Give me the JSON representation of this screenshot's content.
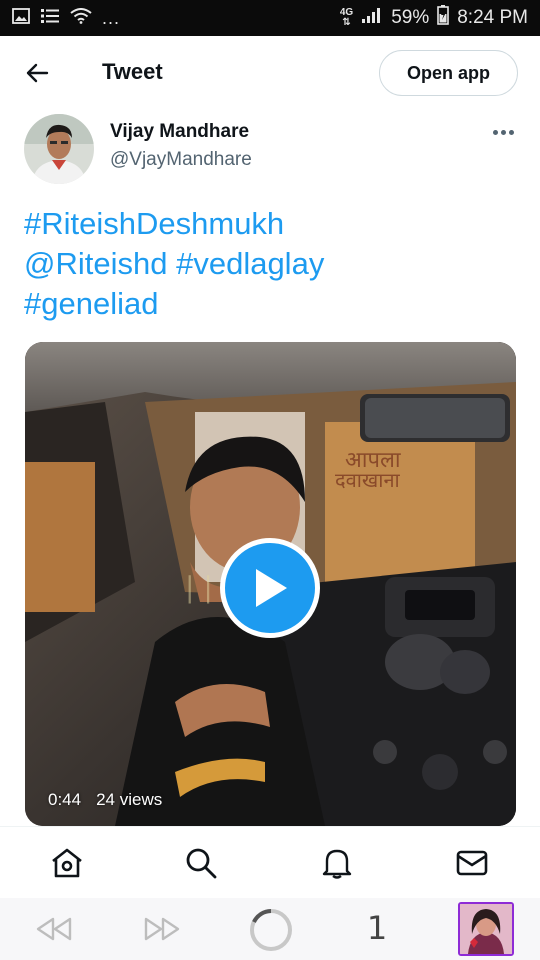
{
  "status_bar": {
    "network_label": "4G",
    "battery": "59%",
    "time": "8:24 PM",
    "overflow_dots": "...",
    "icons": [
      "image-icon",
      "list-icon",
      "wifi-icon",
      "network-arrows-icon",
      "signal-icon",
      "battery-icon"
    ]
  },
  "header": {
    "title": "Tweet",
    "open_app_label": "Open app"
  },
  "author": {
    "name": "Vijay Mandhare",
    "handle": "@VjayMandhare"
  },
  "tweet": {
    "line1": "#RiteishDeshmukh",
    "line2_mention": "@Riteishd",
    "line2_tag": "#vedlaglay",
    "line3": "#geneliad",
    "link_color": "#1d9bf0"
  },
  "video": {
    "duration": "0:44",
    "views": "24 views",
    "play_button_color": "#1d9bf0"
  },
  "bottom_nav": {
    "items": [
      "home-icon",
      "search-icon",
      "notifications-icon",
      "messages-icon"
    ]
  },
  "browser_bar": {
    "tab_count": "1",
    "items": [
      "rewind-icon",
      "forward-icon",
      "loading-icon",
      "tab-count",
      "profile-thumbnail"
    ]
  }
}
